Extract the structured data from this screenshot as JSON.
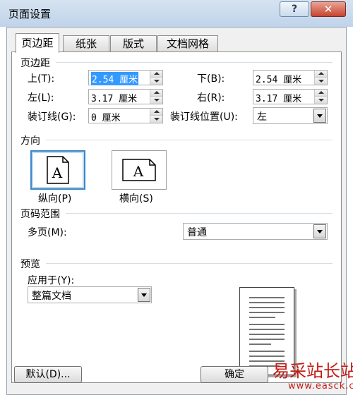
{
  "window": {
    "title": "页面设置",
    "help_symbol": "?",
    "close_symbol": "✕"
  },
  "tabs": [
    {
      "label": "页边距",
      "active": true
    },
    {
      "label": "纸张",
      "active": false
    },
    {
      "label": "版式",
      "active": false
    },
    {
      "label": "文档网格",
      "active": false
    }
  ],
  "margins": {
    "title": "页边距",
    "top": {
      "label": "上(T):",
      "value": "2.54 厘米"
    },
    "bottom": {
      "label": "下(B):",
      "value": "2.54 厘米"
    },
    "left": {
      "label": "左(L):",
      "value": "3.17 厘米"
    },
    "right": {
      "label": "右(R):",
      "value": "3.17 厘米"
    },
    "gutter": {
      "label": "装订线(G):",
      "value": "0 厘米"
    },
    "gutter_position": {
      "label": "装订线位置(U):",
      "value": "左"
    }
  },
  "orientation": {
    "title": "方向",
    "glyph": "A",
    "portrait": {
      "label": "纵向(P)",
      "selected": true
    },
    "landscape": {
      "label": "横向(S)",
      "selected": false
    }
  },
  "pages": {
    "title": "页码范围",
    "multiple_label": "多页(M):",
    "multiple_value": "普通"
  },
  "preview": {
    "title": "预览",
    "apply_label": "应用于(Y):",
    "apply_value": "整篇文档"
  },
  "buttons": {
    "default": "默认(D)...",
    "ok": "确定"
  },
  "watermark": {
    "text": "易采站长站",
    "url": "www.easck.com"
  },
  "colors": {
    "selection": "#3399ff",
    "watermark": "#c21d16",
    "title_bar": "#c8d9ec"
  }
}
